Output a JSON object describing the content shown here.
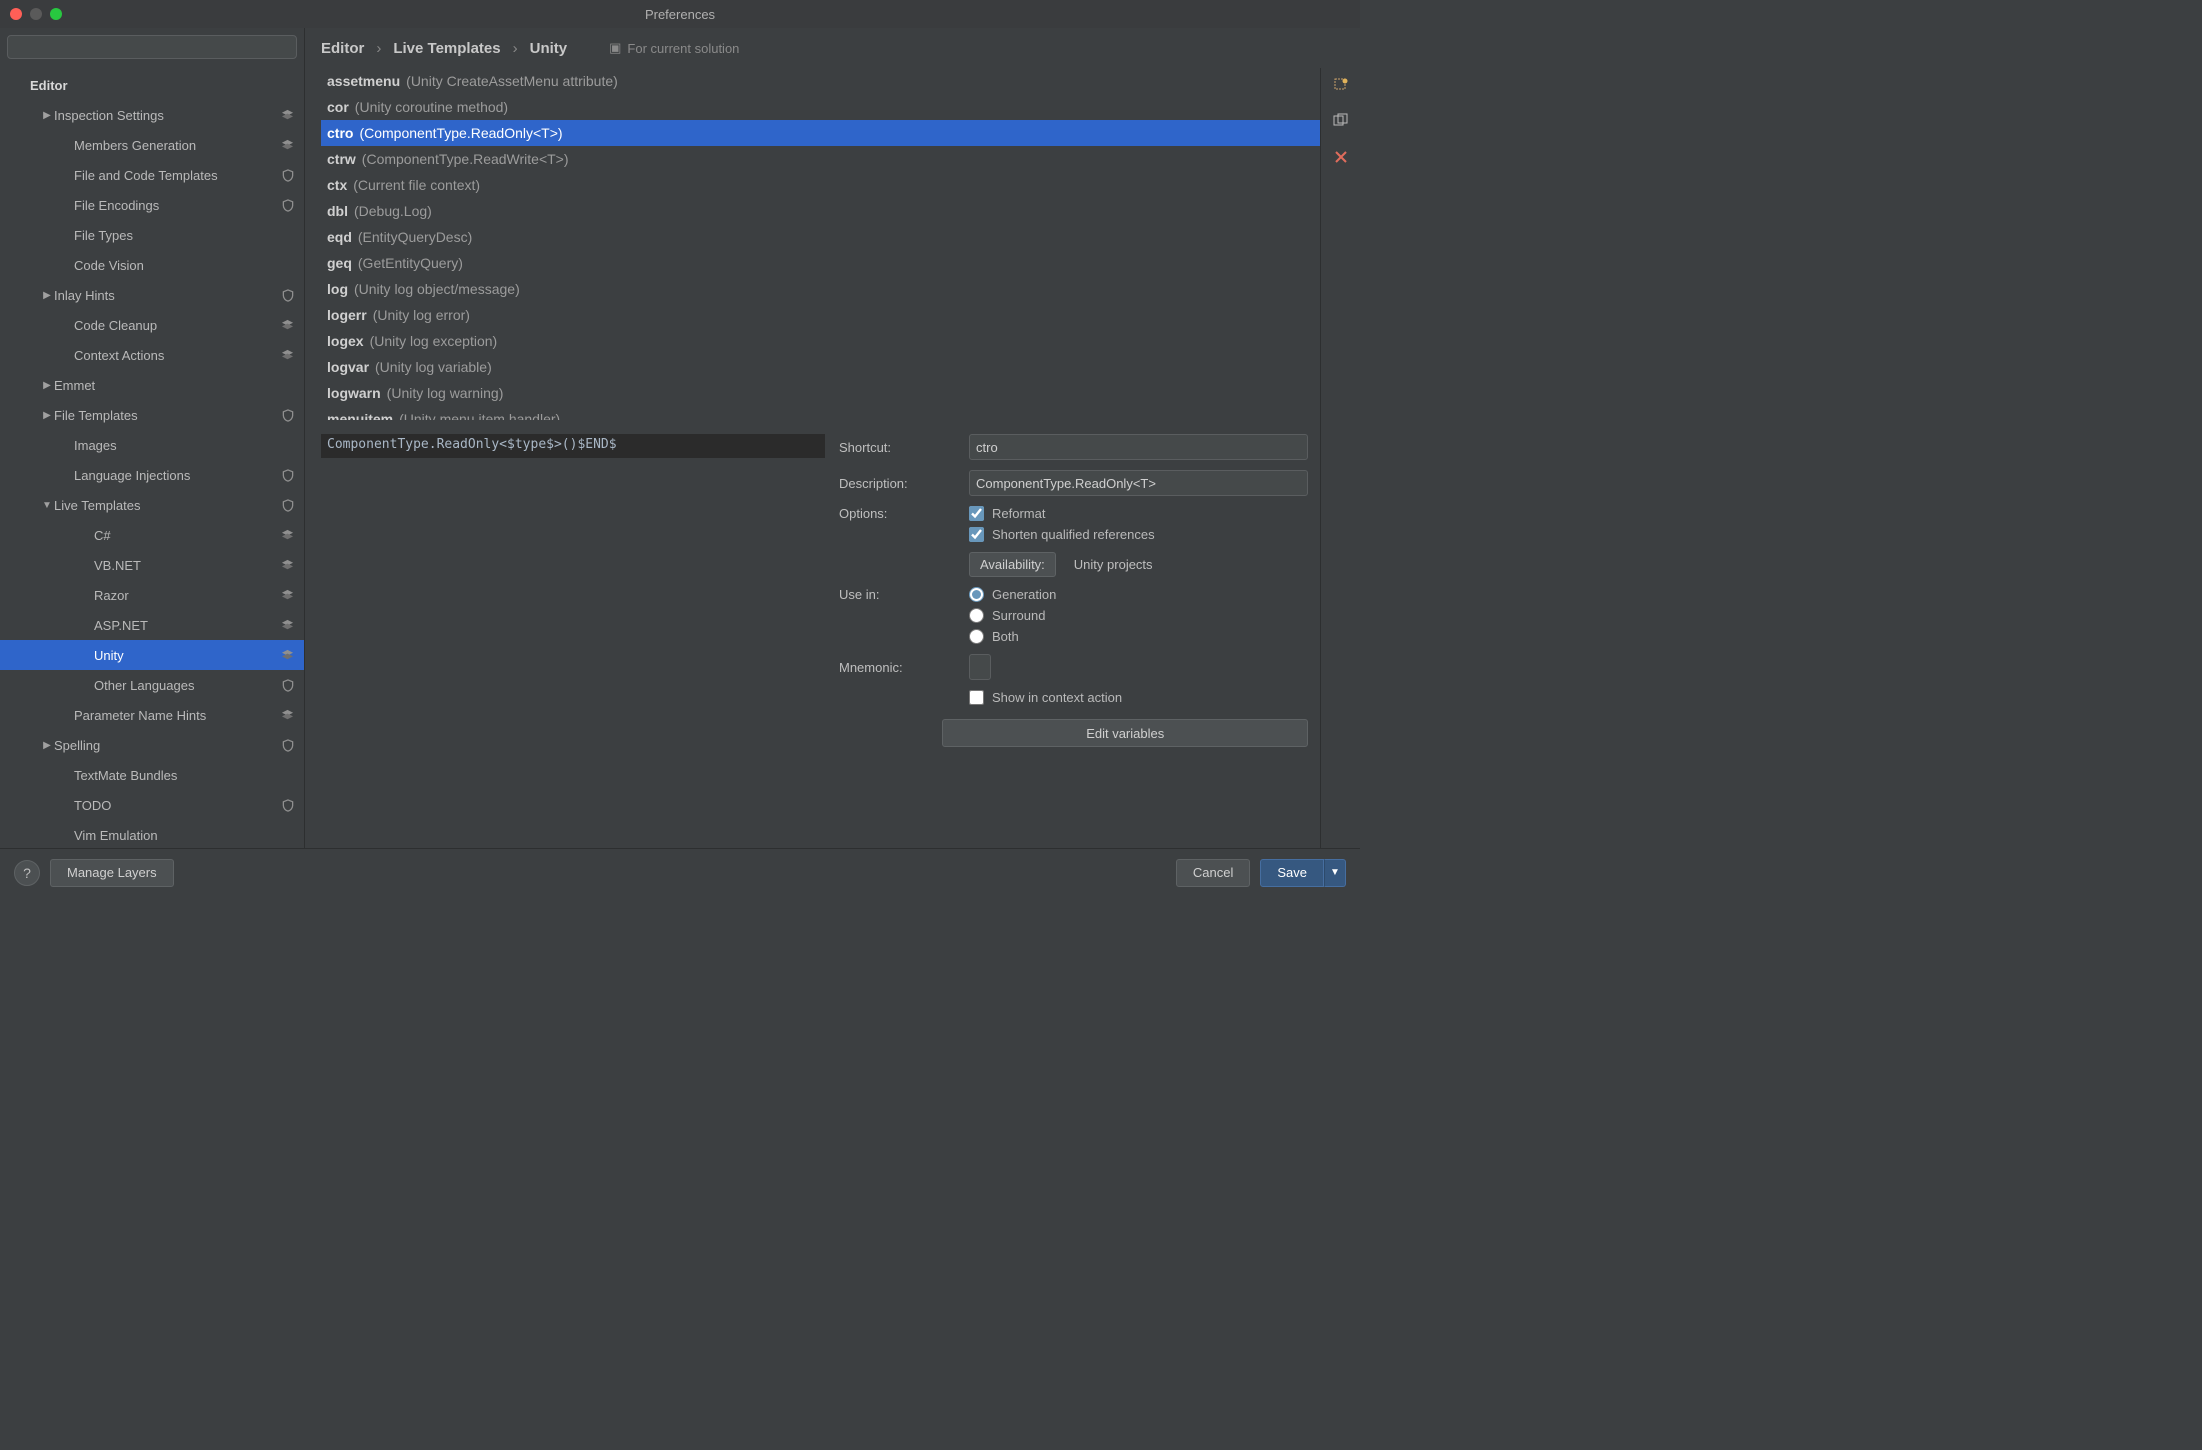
{
  "window": {
    "title": "Preferences"
  },
  "search": {
    "placeholder": ""
  },
  "breadcrumb": {
    "levels": [
      "Editor",
      "Live Templates",
      "Unity"
    ],
    "layer_link": "For current solution"
  },
  "sidebar": {
    "header": "Editor",
    "items": [
      {
        "label": "Inspection Settings",
        "depth": 1,
        "chev": "▶",
        "icon": "layers"
      },
      {
        "label": "Members Generation",
        "depth": 2,
        "chev": "",
        "icon": "layers"
      },
      {
        "label": "File and Code Templates",
        "depth": 2,
        "chev": "",
        "icon": "shield"
      },
      {
        "label": "File Encodings",
        "depth": 2,
        "chev": "",
        "icon": "shield"
      },
      {
        "label": "File Types",
        "depth": 2,
        "chev": "",
        "icon": ""
      },
      {
        "label": "Code Vision",
        "depth": 2,
        "chev": "",
        "icon": ""
      },
      {
        "label": "Inlay Hints",
        "depth": 1,
        "chev": "▶",
        "icon": "shield"
      },
      {
        "label": "Code Cleanup",
        "depth": 2,
        "chev": "",
        "icon": "layers"
      },
      {
        "label": "Context Actions",
        "depth": 2,
        "chev": "",
        "icon": "layers"
      },
      {
        "label": "Emmet",
        "depth": 1,
        "chev": "▶",
        "icon": ""
      },
      {
        "label": "File Templates",
        "depth": 1,
        "chev": "▶",
        "icon": "shield"
      },
      {
        "label": "Images",
        "depth": 2,
        "chev": "",
        "icon": ""
      },
      {
        "label": "Language Injections",
        "depth": 2,
        "chev": "",
        "icon": "shield"
      },
      {
        "label": "Live Templates",
        "depth": 1,
        "chev": "▼",
        "icon": "shield"
      },
      {
        "label": "C#",
        "depth": 3,
        "chev": "",
        "icon": "layers"
      },
      {
        "label": "VB.NET",
        "depth": 3,
        "chev": "",
        "icon": "layers"
      },
      {
        "label": "Razor",
        "depth": 3,
        "chev": "",
        "icon": "layers"
      },
      {
        "label": "ASP.NET",
        "depth": 3,
        "chev": "",
        "icon": "layers"
      },
      {
        "label": "Unity",
        "depth": 3,
        "chev": "",
        "icon": "layers",
        "selected": true
      },
      {
        "label": "Other Languages",
        "depth": 3,
        "chev": "",
        "icon": "shield"
      },
      {
        "label": "Parameter Name Hints",
        "depth": 2,
        "chev": "",
        "icon": "layers"
      },
      {
        "label": "Spelling",
        "depth": 1,
        "chev": "▶",
        "icon": "shield"
      },
      {
        "label": "TextMate Bundles",
        "depth": 2,
        "chev": "",
        "icon": ""
      },
      {
        "label": "TODO",
        "depth": 2,
        "chev": "",
        "icon": "shield"
      },
      {
        "label": "Vim Emulation",
        "depth": 2,
        "chev": "",
        "icon": ""
      }
    ]
  },
  "templates": [
    {
      "abbr": "assetmenu",
      "desc": "(Unity CreateAssetMenu attribute)"
    },
    {
      "abbr": "cor",
      "desc": "(Unity coroutine method)"
    },
    {
      "abbr": "ctro",
      "desc": "(ComponentType.ReadOnly<T>)",
      "selected": true
    },
    {
      "abbr": "ctrw",
      "desc": "(ComponentType.ReadWrite<T>)"
    },
    {
      "abbr": "ctx",
      "desc": "(Current file context)"
    },
    {
      "abbr": "dbl",
      "desc": "(Debug.Log)"
    },
    {
      "abbr": "eqd",
      "desc": "(EntityQueryDesc)"
    },
    {
      "abbr": "geq",
      "desc": "(GetEntityQuery)"
    },
    {
      "abbr": "log",
      "desc": "(Unity log object/message)"
    },
    {
      "abbr": "logerr",
      "desc": "(Unity log error)"
    },
    {
      "abbr": "logex",
      "desc": "(Unity log exception)"
    },
    {
      "abbr": "logvar",
      "desc": "(Unity log variable)"
    },
    {
      "abbr": "logwarn",
      "desc": "(Unity log warning)"
    },
    {
      "abbr": "menuitem",
      "desc": "(Unity menu item handler)"
    }
  ],
  "template_body": "ComponentType.ReadOnly<$type$>()$END$",
  "form": {
    "shortcut_label": "Shortcut:",
    "shortcut_value": "ctro",
    "description_label": "Description:",
    "description_value": "ComponentType.ReadOnly<T>",
    "options_label": "Options:",
    "option_reformat": "Reformat",
    "option_shorten": "Shorten qualified references",
    "availability_btn": "Availability:",
    "availability_value": "Unity projects",
    "usein_label": "Use in:",
    "usein_generation": "Generation",
    "usein_surround": "Surround",
    "usein_both": "Both",
    "mnemonic_label": "Mnemonic:",
    "show_context": "Show in context action",
    "edit_vars": "Edit variables"
  },
  "footer": {
    "manage_layers": "Manage Layers",
    "cancel": "Cancel",
    "save": "Save"
  }
}
